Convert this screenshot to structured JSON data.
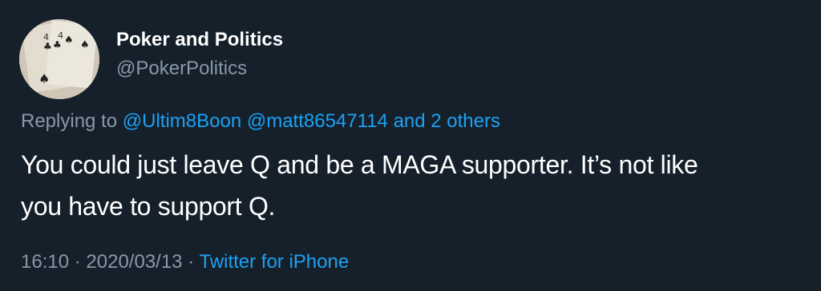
{
  "user": {
    "display_name": "Poker and Politics",
    "handle": "@PokerPolitics",
    "avatar_icon": "playing-cards-avatar"
  },
  "reply": {
    "prefix": "Replying to",
    "mentions": [
      "@Ultim8Boon",
      "@matt86547114"
    ],
    "others": "and 2 others"
  },
  "tweet": {
    "lines": [
      "You could just leave Q and be a MAGA supporter. It’s not like",
      "you have to support Q."
    ]
  },
  "meta": {
    "time": "16:10",
    "separator": "·",
    "date": "2020/03/13",
    "source": "Twitter for iPhone"
  },
  "colors": {
    "background": "#15202b",
    "text_primary": "#ffffff",
    "text_secondary": "#8899a6",
    "link": "#1da1f2"
  }
}
